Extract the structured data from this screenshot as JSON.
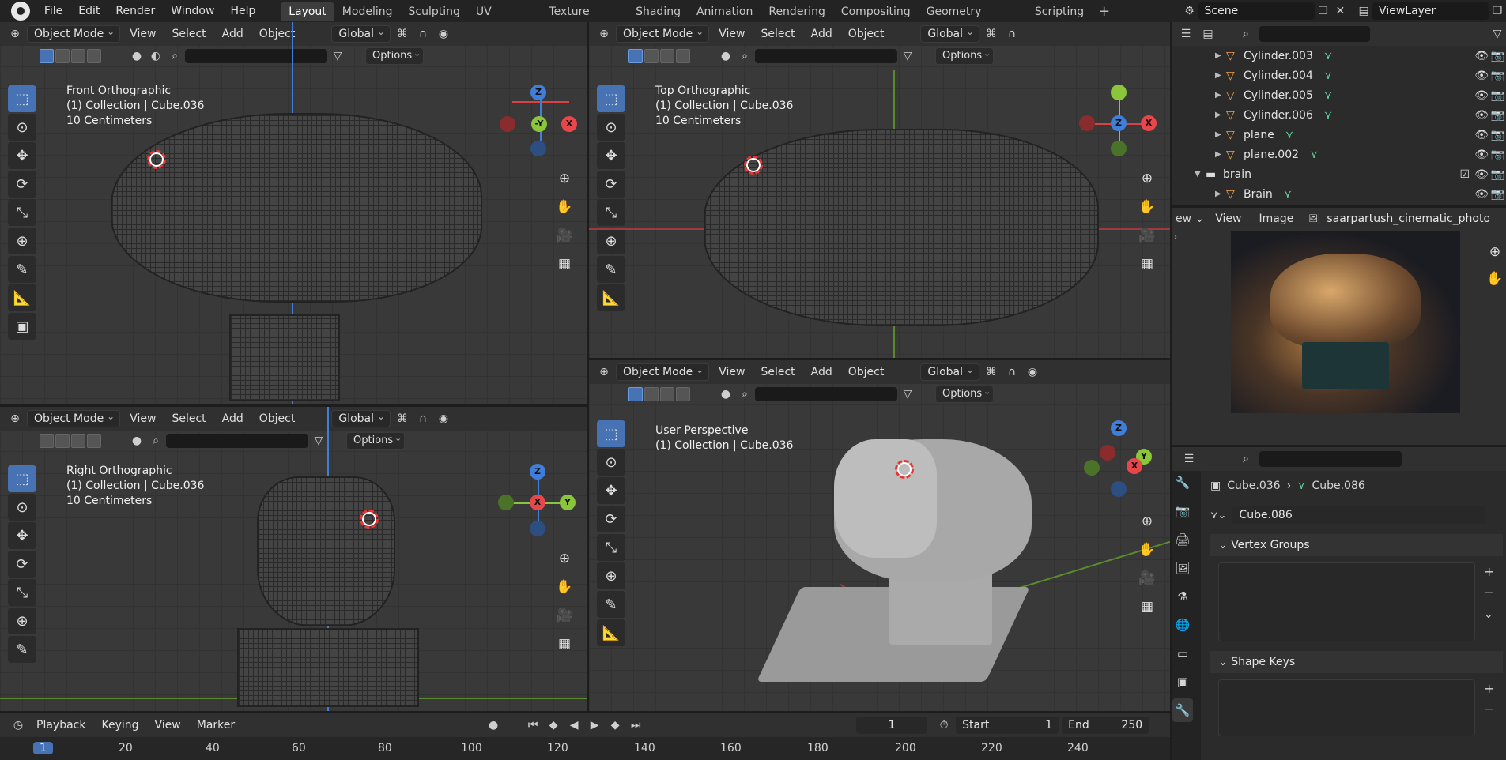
{
  "topbar": {
    "menus": [
      "File",
      "Edit",
      "Render",
      "Window",
      "Help"
    ],
    "workspaces": [
      "Layout",
      "Modeling",
      "Sculpting",
      "UV Editing",
      "Texture Paint",
      "Shading",
      "Animation",
      "Rendering",
      "Compositing",
      "Geometry Nodes",
      "Scripting"
    ],
    "active_workspace": "Layout",
    "scene": "Scene",
    "view_layer": "ViewLayer"
  },
  "viewport_header": {
    "mode": "Object Mode",
    "menus": [
      "View",
      "Select",
      "Add",
      "Object"
    ],
    "transform": "Global",
    "options": "Options"
  },
  "viewports": {
    "front": {
      "title": "Front Orthographic",
      "collection": "(1) Collection | Cube.036",
      "scale": "10 Centimeters",
      "axis_up": "Z",
      "axis_center": "-Y",
      "axis_right": "X"
    },
    "top": {
      "title": "Top Orthographic",
      "collection": "(1) Collection | Cube.036",
      "scale": "10 Centimeters",
      "axis_up": "Y",
      "axis_center": "Z",
      "axis_right": "X"
    },
    "right": {
      "title": "Right Orthographic",
      "collection": "(1) Collection | Cube.036",
      "scale": "10 Centimeters",
      "axis_up": "Z",
      "axis_center": "X",
      "axis_right": "Y"
    },
    "persp": {
      "title": "User Perspective",
      "collection": "(1) Collection | Cube.036",
      "axis_up": "Z",
      "axis_x": "X",
      "axis_y": "Y"
    }
  },
  "outliner": {
    "items": [
      {
        "name": "Cylinder.003",
        "type": "mesh"
      },
      {
        "name": "Cylinder.004",
        "type": "mesh"
      },
      {
        "name": "Cylinder.005",
        "type": "mesh"
      },
      {
        "name": "Cylinder.006",
        "type": "mesh"
      },
      {
        "name": "plane",
        "type": "mesh"
      },
      {
        "name": "plane.002",
        "type": "mesh"
      },
      {
        "name": "brain",
        "type": "collection"
      },
      {
        "name": "Brain",
        "type": "mesh"
      }
    ]
  },
  "image_editor": {
    "menus": [
      "View",
      "Image"
    ],
    "image_name": "saarpartush_cinematic_photo_of"
  },
  "properties": {
    "object": "Cube.036",
    "mesh": "Cube.086",
    "datablock": "Cube.086",
    "sections": [
      "Vertex Groups",
      "Shape Keys"
    ]
  },
  "timeline": {
    "menus": [
      "Playback",
      "Keying",
      "View",
      "Marker"
    ],
    "current_frame": "1",
    "start_label": "Start",
    "start": "1",
    "end_label": "End",
    "end": "250",
    "ticks": [
      "1",
      "20",
      "40",
      "60",
      "80",
      "100",
      "120",
      "140",
      "160",
      "180",
      "200",
      "220",
      "240"
    ]
  },
  "colors": {
    "accent": "#4772b3",
    "x_axis": "#e8464a",
    "y_axis": "#8bc53a",
    "z_axis": "#3f7fd9"
  }
}
